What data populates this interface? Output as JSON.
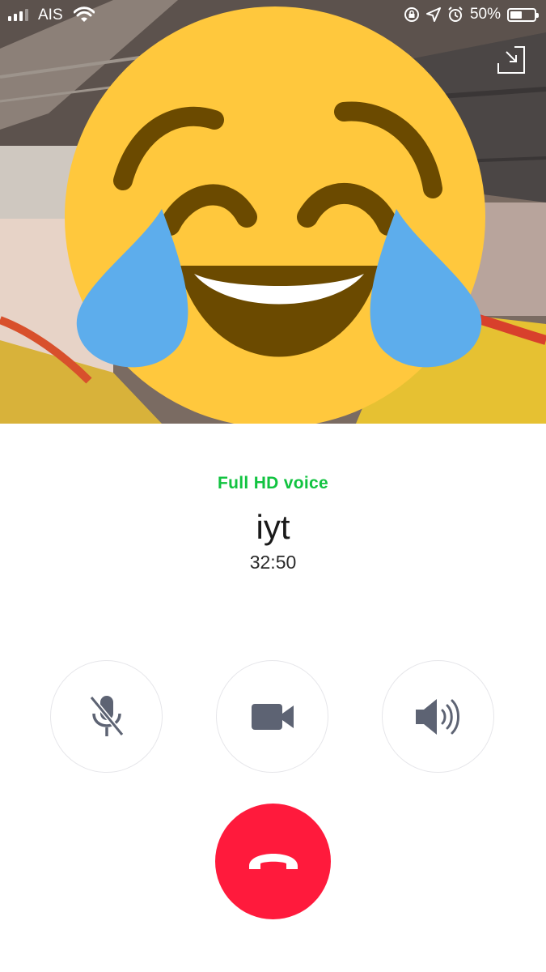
{
  "status_bar": {
    "carrier": "AIS",
    "battery": "50%",
    "battery_level": 0.5,
    "icons": [
      "signal-icon",
      "wifi-icon",
      "rotation-lock-icon",
      "location-icon",
      "alarm-icon",
      "battery-icon"
    ]
  },
  "call": {
    "quality_label": "Full HD voice",
    "contact_name": "iyt",
    "duration": "32:50"
  },
  "controls": {
    "mute_icon": "mic-off-icon",
    "video_icon": "video-camera-icon",
    "speaker_icon": "speaker-icon",
    "end_call_icon": "end-call-icon",
    "minimize_icon": "minimize-icon"
  },
  "colors": {
    "hd_green": "#11c340",
    "end_call_red": "#ff1a3c",
    "icon_gray": "#5d6373"
  }
}
